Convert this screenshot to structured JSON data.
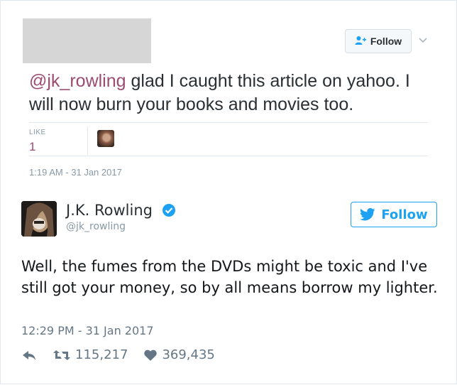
{
  "reply_tweet": {
    "follow_label": "Follow",
    "mention": "@jk_rowling",
    "text_rest": " glad I caught this article on yahoo. I will now burn your books and movies too.",
    "like_label": "LIKE",
    "like_count": "1",
    "timestamp": "1:19 AM - 31 Jan 2017"
  },
  "main_tweet": {
    "name": "J.K. Rowling",
    "handle": "@jk_rowling",
    "follow_label": "Follow",
    "text": "Well, the fumes from the DVDs might be toxic and I've still got your money, so by all means borrow my lighter.",
    "timestamp": "12:29 PM - 31 Jan 2017",
    "retweets": "115,217",
    "likes": "369,435"
  },
  "colors": {
    "twitter_blue": "#1da1f2",
    "mention": "#9c4b73",
    "muted": "#8899a6",
    "border": "#e1e8ed"
  },
  "icons": [
    "add-user-icon",
    "chevron-down-icon",
    "verified-badge-icon",
    "twitter-bird-icon",
    "reply-icon",
    "retweet-icon",
    "heart-icon"
  ]
}
